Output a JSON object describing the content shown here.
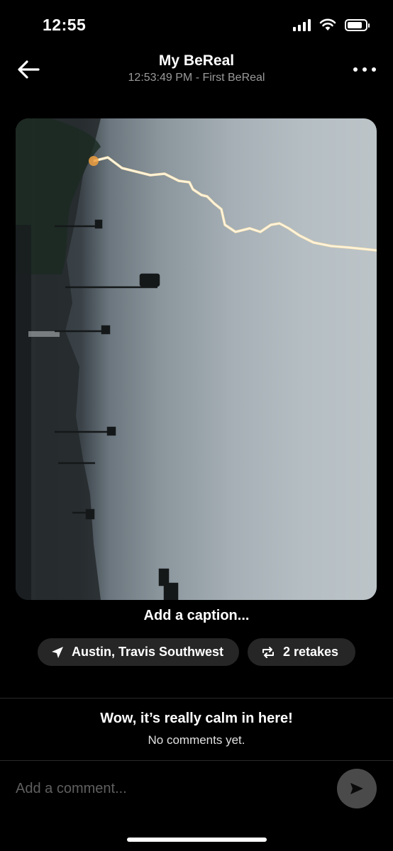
{
  "status_bar": {
    "time": "12:55"
  },
  "header": {
    "title": "My BeReal",
    "subtitle": "12:53:49 PM - First BeReal"
  },
  "post": {
    "caption_placeholder": "Add a caption...",
    "location": "Austin, Travis Southwest",
    "retakes": "2 retakes"
  },
  "comments": {
    "empty_title": "Wow, it’s really calm in here!",
    "empty_subtitle": "No comments yet.",
    "input_placeholder": "Add a comment..."
  },
  "icons": {
    "back": "arrow-left-icon",
    "more": "ellipsis-icon",
    "location": "navigation-arrow-icon",
    "retakes": "repeat-icon",
    "send": "send-icon"
  },
  "colors": {
    "background": "#000000",
    "chip": "#262626",
    "send_button": "#4a4a4a",
    "secondary_text": "#9a9a9a"
  }
}
